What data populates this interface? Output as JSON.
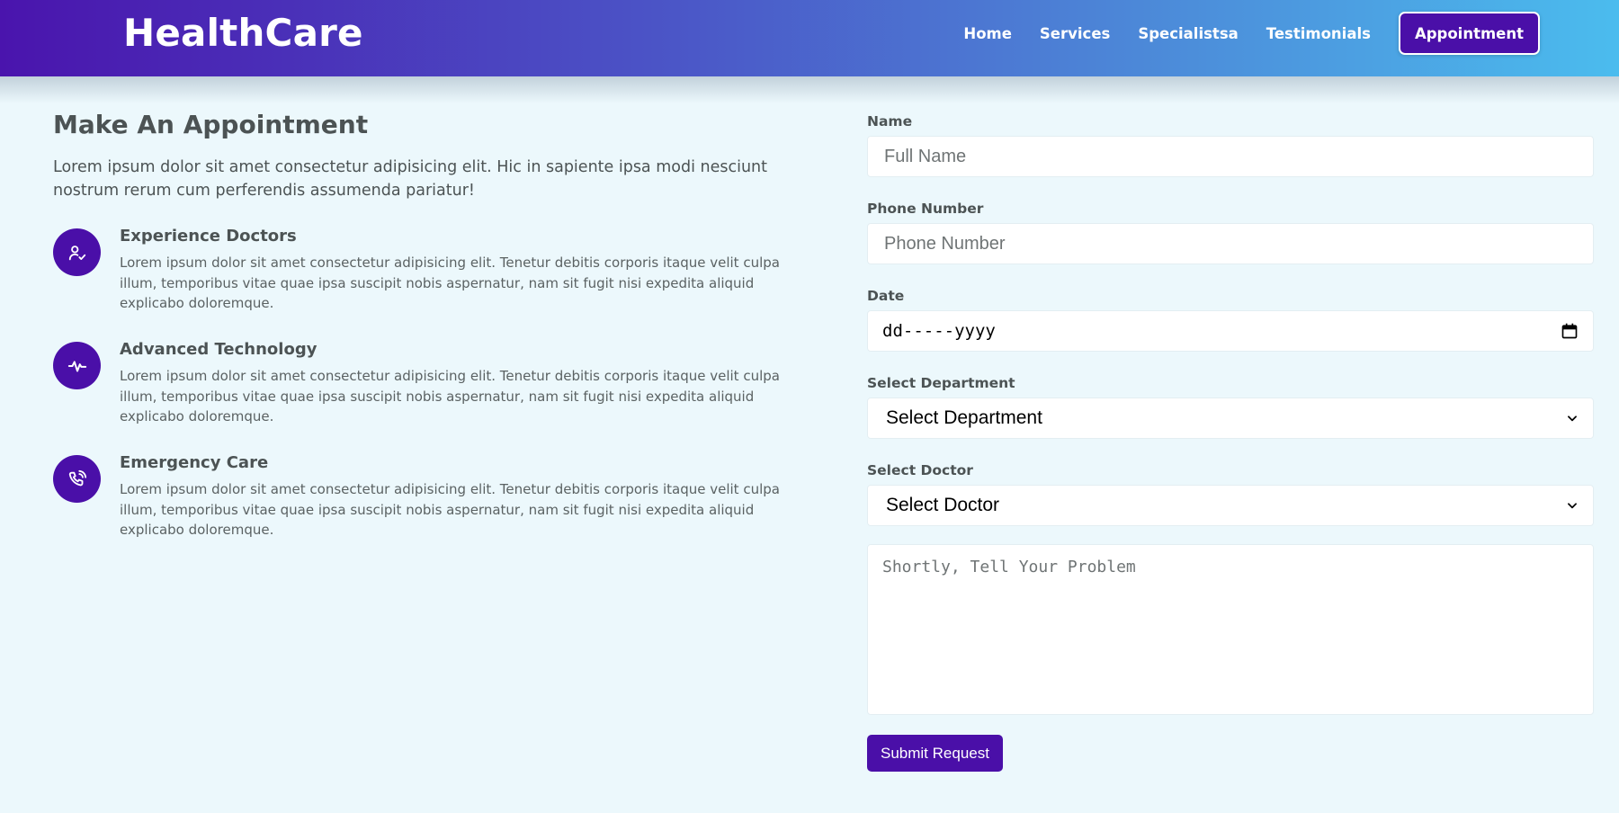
{
  "brand": {
    "logo": "HealthCare"
  },
  "nav": {
    "links": [
      "Home",
      "Services",
      "Specialistsa",
      "Testimonials"
    ],
    "cta": "Appointment"
  },
  "appointment": {
    "title": "Make An Appointment",
    "intro": "Lorem ipsum dolor sit amet consectetur adipisicing elit. Hic in sapiente ipsa modi nesciunt nostrum rerum cum perferendis assumenda pariatur!",
    "features": [
      {
        "title": "Experience Doctors",
        "icon": "doctor-check-icon",
        "text": "Lorem ipsum dolor sit amet consectetur adipisicing elit. Tenetur debitis corporis itaque velit culpa illum, temporibus vitae quae ipsa suscipit nobis aspernatur, nam sit fugit nisi expedita aliquid explicabo doloremque."
      },
      {
        "title": "Advanced Technology",
        "icon": "heartbeat-icon",
        "text": "Lorem ipsum dolor sit amet consectetur adipisicing elit. Tenetur debitis corporis itaque velit culpa illum, temporibus vitae quae ipsa suscipit nobis aspernatur, nam sit fugit nisi expedita aliquid explicabo doloremque."
      },
      {
        "title": "Emergency Care",
        "icon": "phone-call-icon",
        "text": "Lorem ipsum dolor sit amet consectetur adipisicing elit. Tenetur debitis corporis itaque velit culpa illum, temporibus vitae quae ipsa suscipit nobis aspernatur, nam sit fugit nisi expedita aliquid explicabo doloremque."
      }
    ]
  },
  "form": {
    "name_label": "Name",
    "name_placeholder": "Full Name",
    "phone_label": "Phone Number",
    "phone_placeholder": "Phone Number",
    "date_label": "Date",
    "date_value": "dd-----yyyy",
    "department_label": "Select Department",
    "department_value": "Select Department",
    "doctor_label": "Select Doctor",
    "doctor_value": "Select Doctor",
    "problem_placeholder": "Shortly, Tell Your Problem",
    "submit_label": "Submit Request"
  },
  "colors": {
    "primary": "#4a0fa8",
    "header_gradient_start": "#4a14ad",
    "header_gradient_end": "#4bbcee",
    "page_background": "#ecf8fc",
    "text": "#4c5354"
  }
}
